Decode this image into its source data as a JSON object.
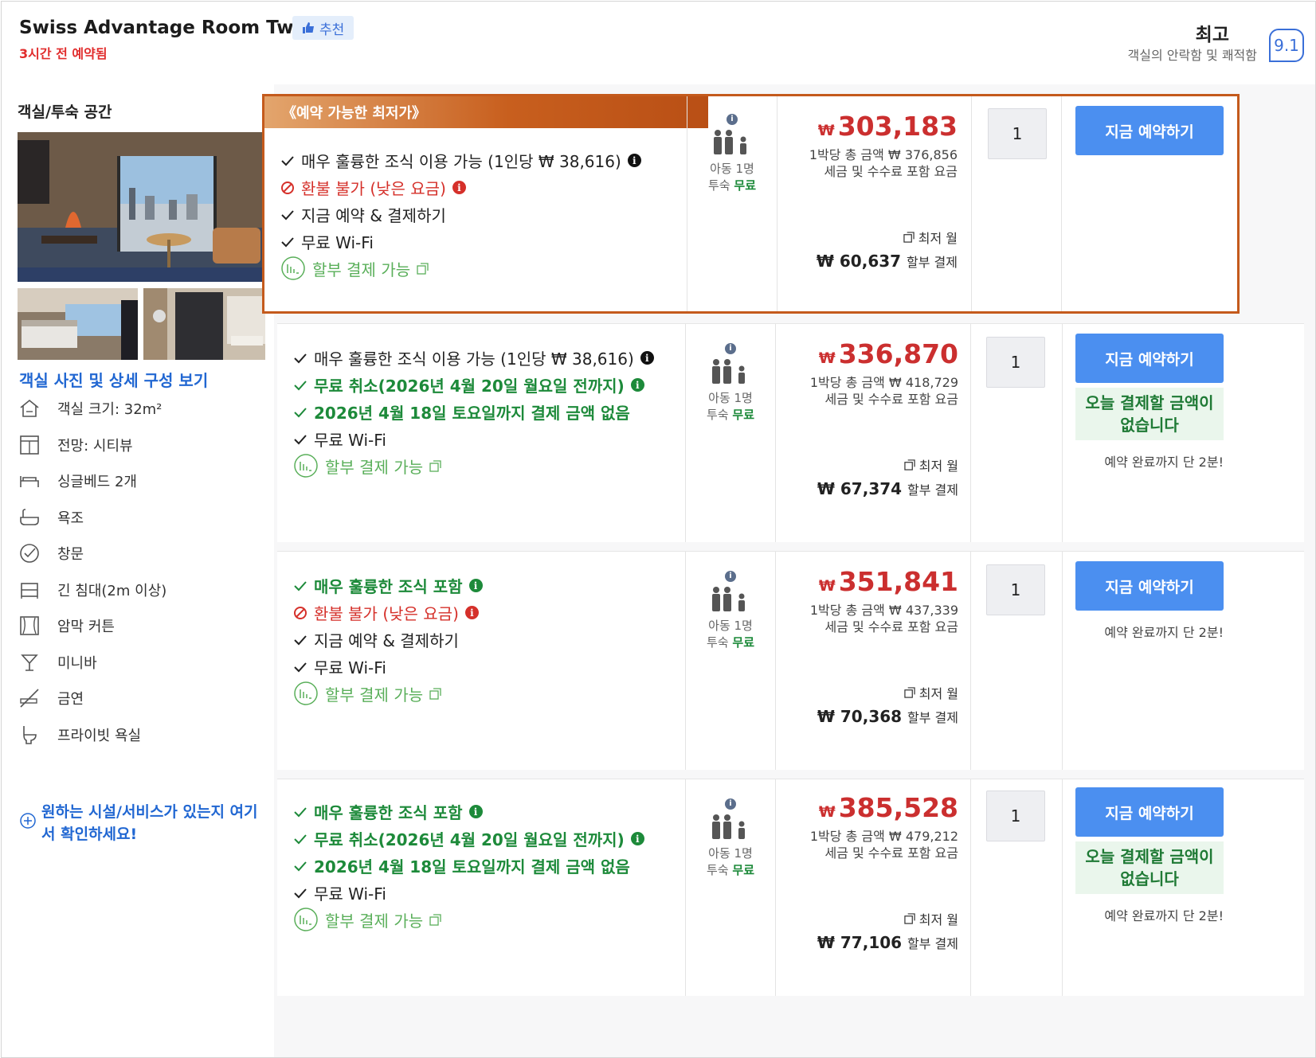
{
  "header": {
    "room_title": "Swiss Advantage Room Twin",
    "recommend_badge": "추천",
    "booked_notice": "3시간 전 예약됨",
    "score_word": "최고",
    "score_subtitle": "객실의 안락함 및 쾌적함",
    "score": "9.1"
  },
  "left": {
    "section_title": "객실/투숙 공간",
    "room_link": "객실 사진 및 상세 구성 보기",
    "amenities": [
      {
        "icon": "house-icon",
        "label": "객실 크기: 32m²"
      },
      {
        "icon": "window-view-icon",
        "label": "전망: 시티뷰"
      },
      {
        "icon": "bed-icon",
        "label": "싱글베드 2개"
      },
      {
        "icon": "bathtub-icon",
        "label": "욕조"
      },
      {
        "icon": "check-circle-icon",
        "label": "창문"
      },
      {
        "icon": "long-bed-icon",
        "label": "긴 침대(2m 이상)"
      },
      {
        "icon": "curtain-icon",
        "label": "암막 커튼"
      },
      {
        "icon": "cocktail-icon",
        "label": "미니바"
      },
      {
        "icon": "no-smoking-icon",
        "label": "금연"
      },
      {
        "icon": "toilet-icon",
        "label": "프라이빗 욕실"
      }
    ],
    "check_more": "원하는 시설/서비스가 있는지 여기서 확인하세요!"
  },
  "common": {
    "guest_children": "아동 1명",
    "guest_stay": "투숙",
    "guest_free": "무료",
    "currency": "₩",
    "price_sub_prefix": "1박당 총 금액 ₩",
    "price_sub_2": "세금 및 수수료 포함 요금",
    "monthly_header": "최저 월",
    "monthly_suffix": "할부 결제",
    "book_button": "지금 예약하기",
    "no_pay_today": "오늘 결제할 금액이 없습니다",
    "minutes_left": "예약 완료까지 단 2분!",
    "installment": "할부 결제 가능",
    "wifi": "무료 Wi-Fi"
  },
  "offers": [
    {
      "tag": "《예약 가능한 최저가》",
      "features": [
        {
          "text": "매우 훌륭한 조식 이용 가능 (1인당 ₩ 38,616)",
          "style": "normal"
        },
        {
          "text": "환불 불가 (낮은 요금)",
          "style": "red"
        },
        {
          "text": "지금 예약 & 결제하기",
          "style": "normal"
        },
        {
          "text": "무료 Wi-Fi",
          "style": "normal"
        }
      ],
      "price": "303,183",
      "total": "376,856",
      "monthly": "₩ 60,637",
      "qty": "1"
    },
    {
      "features": [
        {
          "text": "매우 훌륭한 조식 이용 가능 (1인당 ₩ 38,616)",
          "style": "normal"
        },
        {
          "text": "무료 취소(2026년 4월 20일 월요일 전까지)",
          "style": "green"
        },
        {
          "text": "2026년 4월 18일 토요일까지 결제 금액 없음",
          "style": "green"
        },
        {
          "text": "무료 Wi-Fi",
          "style": "normal"
        }
      ],
      "price": "336,870",
      "total": "418,729",
      "monthly": "₩ 67,374",
      "qty": "1"
    },
    {
      "features": [
        {
          "text": "매우 훌륭한 조식 포함",
          "style": "green"
        },
        {
          "text": "환불 불가 (낮은 요금)",
          "style": "red"
        },
        {
          "text": "지금 예약 & 결제하기",
          "style": "normal"
        },
        {
          "text": "무료 Wi-Fi",
          "style": "normal"
        }
      ],
      "price": "351,841",
      "total": "437,339",
      "monthly": "₩ 70,368",
      "qty": "1"
    },
    {
      "features": [
        {
          "text": "매우 훌륭한 조식 포함",
          "style": "green"
        },
        {
          "text": "무료 취소(2026년 4월 20일 월요일 전까지)",
          "style": "green"
        },
        {
          "text": "2026년 4월 18일 토요일까지 결제 금액 없음",
          "style": "green"
        },
        {
          "text": "무료 Wi-Fi",
          "style": "normal"
        }
      ],
      "price": "385,528",
      "total": "479,212",
      "monthly": "₩ 77,106",
      "qty": "1"
    }
  ],
  "colors": {
    "accent_blue": "#4b8ff0",
    "price_red": "#cb2f2f",
    "green": "#1d8a3a",
    "highlight_orange": "#c45a1c"
  }
}
